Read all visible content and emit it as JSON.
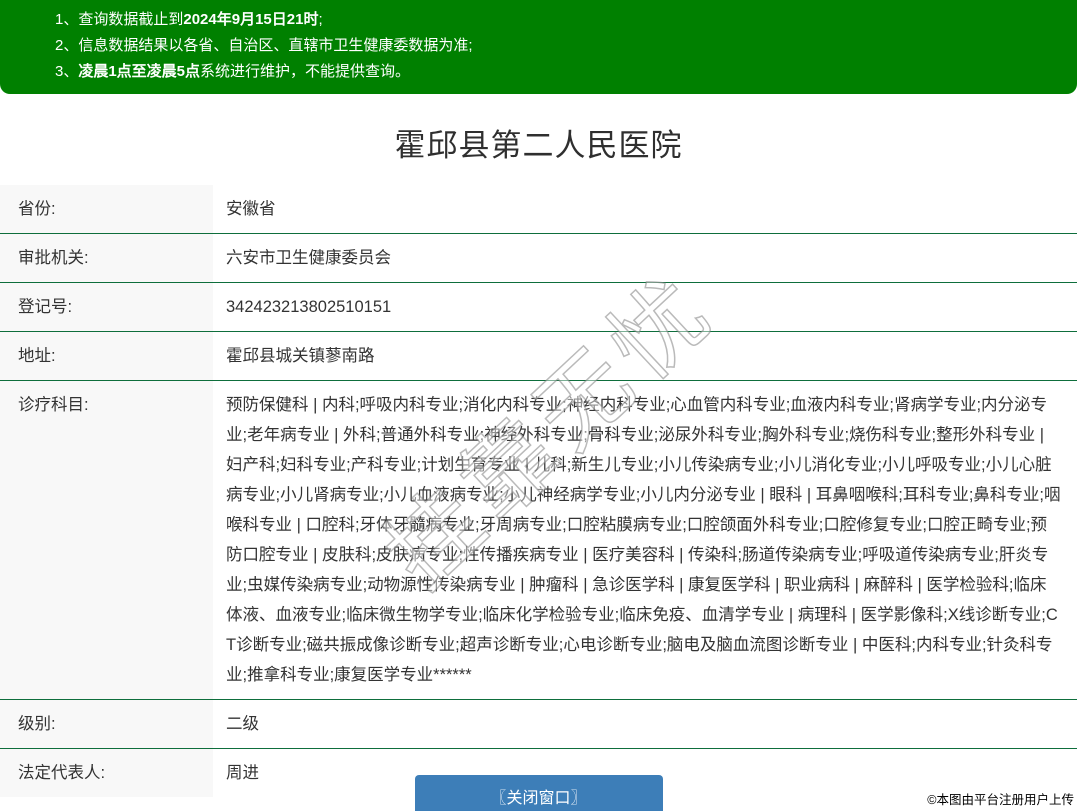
{
  "notice": {
    "lines": [
      {
        "num": "1、",
        "pre": "查询数据截止到",
        "bold": "2024年9月15日21时",
        "post": ";"
      },
      {
        "num": "2、",
        "pre": "信息数据结果以各省、自治区、直辖市卫生健康委数据为准;",
        "bold": "",
        "post": ""
      },
      {
        "num": "3、",
        "pre": "",
        "bold": "凌晨1点至凌晨5点",
        "post": "系统进行维护，不能提供查询。"
      }
    ]
  },
  "title": "霍邱县第二人民医院",
  "table": {
    "rows": [
      {
        "label": "省份:",
        "value": "安徽省"
      },
      {
        "label": "审批机关:",
        "value": "六安市卫生健康委员会"
      },
      {
        "label": "登记号:",
        "value": "342423213802510151"
      },
      {
        "label": "地址:",
        "value": "霍邱县城关镇蓼南路"
      },
      {
        "label": "诊疗科目:",
        "value": "预防保健科 | 内科;呼吸内科专业;消化内科专业;神经内科专业;心血管内科专业;血液内科专业;肾病学专业;内分泌专业;老年病专业 | 外科;普通外科专业;神经外科专业;骨科专业;泌尿外科专业;胸外科专业;烧伤科专业;整形外科专业 | 妇产科;妇科专业;产科专业;计划生育专业 | 儿科;新生儿专业;小儿传染病专业;小儿消化专业;小儿呼吸专业;小儿心脏病专业;小儿肾病专业;小儿血液病专业;小儿神经病学专业;小儿内分泌专业 | 眼科 | 耳鼻咽喉科;耳科专业;鼻科专业;咽喉科专业 | 口腔科;牙体牙髓病专业;牙周病专业;口腔粘膜病专业;口腔颌面外科专业;口腔修复专业;口腔正畸专业;预防口腔专业 | 皮肤科;皮肤病专业;性传播疾病专业 | 医疗美容科 | 传染科;肠道传染病专业;呼吸道传染病专业;肝炎专业;虫媒传染病专业;动物源性传染病专业 | 肿瘤科 | 急诊医学科 | 康复医学科 | 职业病科 | 麻醉科 | 医学检验科;临床体液、血液专业;临床微生物学专业;临床化学检验专业;临床免疫、血清学专业 | 病理科 | 医学影像科;X线诊断专业;CT诊断专业;磁共振成像诊断专业;超声诊断专业;心电诊断专业;脑电及脑血流图诊断专业 | 中医科;内科专业;针灸科专业;推拿科专业;康复医学专业******"
      },
      {
        "label": "级别:",
        "value": "二级"
      },
      {
        "label": "法定代表人:",
        "value": "周进"
      }
    ]
  },
  "watermark": "挂靠无忧",
  "close_button": "〖关闭窗口〗",
  "footer": "©本图由平台注册用户上传",
  "colors": {
    "banner_green": "#008000",
    "divider_green": "#0e6e3c",
    "button_blue": "#3d7eb8",
    "label_bg": "#f8f8f8"
  }
}
